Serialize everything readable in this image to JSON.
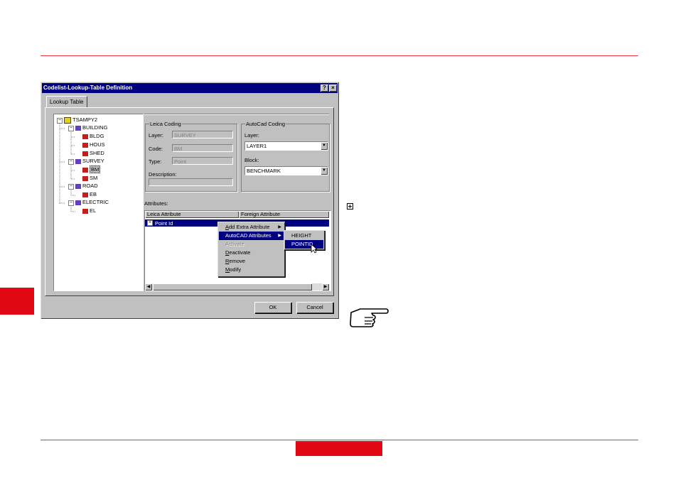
{
  "dialog": {
    "title": "Codelist-Lookup-Table Definition",
    "help_label": "?",
    "close_label": "×",
    "tab_label": "Lookup Table",
    "ok_label": "OK",
    "cancel_label": "Cancel"
  },
  "tree": {
    "root": "TSAMPY2",
    "items": [
      {
        "label": "BUILDING",
        "kind": "group"
      },
      {
        "label": "BLDG",
        "kind": "code"
      },
      {
        "label": "HOUS",
        "kind": "code"
      },
      {
        "label": "SHED",
        "kind": "code"
      },
      {
        "label": "SURVEY",
        "kind": "group"
      },
      {
        "label": "BM",
        "kind": "code",
        "selected": true
      },
      {
        "label": "SM",
        "kind": "code"
      },
      {
        "label": "ROAD",
        "kind": "group"
      },
      {
        "label": "EB",
        "kind": "code"
      },
      {
        "label": "ELECTRIC",
        "kind": "group"
      },
      {
        "label": "EL",
        "kind": "code"
      }
    ]
  },
  "leica": {
    "group_label": "Leica Coding",
    "layer_label": "Layer:",
    "layer_value": "SURVEY",
    "code_label": "Code:",
    "code_value": "BM",
    "type_label": "Type:",
    "type_value": "Point",
    "description_label": "Description:",
    "description_value": ""
  },
  "autocad": {
    "group_label": "AutoCad Coding",
    "layer_label": "Layer:",
    "layer_value": "LAYER1",
    "block_label": "Block:",
    "block_value": "BENCHMARK"
  },
  "attributes": {
    "label": "Attributes:",
    "col_leica": "Leica Attribute",
    "col_foreign": "Foreign Attribute",
    "row_label": "Point Id",
    "expand_glyph": "+"
  },
  "context_menu": {
    "items": [
      {
        "mnemonic": "A",
        "rest": "dd Extra Attribute",
        "submenu": true
      },
      {
        "mnemonic": "",
        "rest": "AutoCAD Attributes",
        "submenu": true,
        "highlighted": true
      },
      {
        "mnemonic": "",
        "rest": "Activate",
        "disabled": true
      },
      {
        "mnemonic": "D",
        "rest": "eactivate"
      },
      {
        "mnemonic": "R",
        "rest": "emove"
      },
      {
        "mnemonic": "M",
        "rest": "odify"
      }
    ]
  },
  "submenu": {
    "items": [
      "HEIGHT",
      "POINTID"
    ]
  },
  "side_icon": "expand-box-icon",
  "note_icon": "pointing-hand-icon",
  "colors": {
    "accent": "#e10914",
    "titlebar": "#000080",
    "face": "#c0c0c0"
  }
}
